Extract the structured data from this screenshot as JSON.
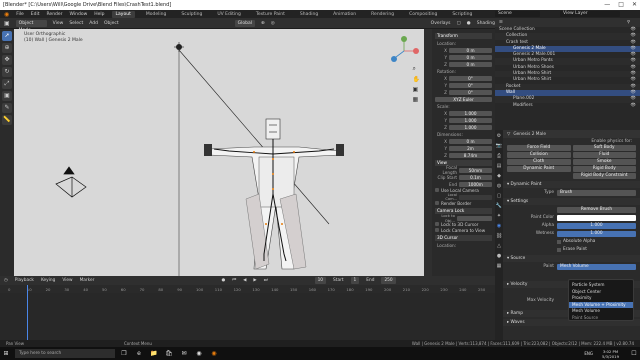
{
  "window": {
    "title": "[Blender* [C:\\Users\\Will\\Google Drive\\Blend Files\\CrashTest1.blend]",
    "controls": [
      "—",
      "□",
      "✕"
    ]
  },
  "menubar": {
    "menus": [
      "File",
      "Edit",
      "Render",
      "Window",
      "Help"
    ],
    "workspaces": [
      "Layout",
      "Modeling",
      "Sculpting",
      "UV Editing",
      "Texture Paint",
      "Shading",
      "Animation",
      "Rendering",
      "Compositing",
      "Scripting"
    ],
    "active_workspace": "Layout",
    "scene": "Scene",
    "view_layer": "View Layer"
  },
  "viewport_header": {
    "mode": "Object Mode",
    "menus": [
      "View",
      "Select",
      "Add",
      "Object"
    ],
    "transform": "Global",
    "overlays": "Overlays",
    "shading": "Shading"
  },
  "viewport": {
    "view_name": "User Orthographic",
    "object_name": "(10) Wall | Genesis 2 Male"
  },
  "tool_icons": [
    "cursor-icon",
    "move-icon",
    "rotate-icon",
    "scale-icon",
    "transform-icon",
    "annotate-icon",
    "measure-icon"
  ],
  "npanel": {
    "transform_title": "Transform",
    "location_label": "Location:",
    "location": {
      "x": "0 m",
      "y": "0 m",
      "z": "0 m"
    },
    "rotation_label": "Rotation:",
    "rotation": {
      "x": "0°",
      "y": "0°",
      "z": "0°"
    },
    "rotation_mode": "XYZ Euler",
    "scale_label": "Scale:",
    "scale": {
      "x": "1.000",
      "y": "1.000",
      "z": "1.000"
    },
    "dimensions_label": "Dimensions:",
    "dimensions": {
      "x": "0 m",
      "y": "2m",
      "z": "8.74m"
    },
    "view_title": "View",
    "focal_length_label": "Focal Length",
    "focal_length": "50mm",
    "clip_start_label": "Clip Start",
    "clip_start": "0.1m",
    "clip_end_label": "End",
    "clip_end": "1000m",
    "use_local_camera": "Use Local Camera",
    "local_camera_label": "Local Cam...",
    "render_border": "Render Border",
    "camera_lock_title": "Camera Lock",
    "lock_to_obj": "Lock to Obj...",
    "lock_to_3d_cursor": "Lock to 3D Cursor",
    "lock_camera_to_view": "Lock Camera to View",
    "cursor_title": "3D Cursor",
    "cursor_location_label": "Location:"
  },
  "outliner": {
    "rows": [
      {
        "label": "Scene Collection",
        "indent": 0,
        "selected": false
      },
      {
        "label": "Collection",
        "indent": 1,
        "selected": false
      },
      {
        "label": "Crash test",
        "indent": 1,
        "selected": false
      },
      {
        "label": "Genesis 2 Male",
        "indent": 2,
        "selected": true
      },
      {
        "label": "Genesis 2 Male.001",
        "indent": 2,
        "selected": false
      },
      {
        "label": "Urban Metro Pants",
        "indent": 2,
        "selected": false
      },
      {
        "label": "Urban Metro Shoes",
        "indent": 2,
        "selected": false
      },
      {
        "label": "Urban Metro Shirt",
        "indent": 2,
        "selected": false
      },
      {
        "label": "Urban Metro Shirt",
        "indent": 2,
        "selected": false
      },
      {
        "label": "Rocket",
        "indent": 1,
        "selected": false
      },
      {
        "label": "Wall",
        "indent": 1,
        "selected": true
      },
      {
        "label": "Plane.002",
        "indent": 2,
        "selected": false
      },
      {
        "label": "Modifiers",
        "indent": 2,
        "selected": false
      }
    ]
  },
  "properties": {
    "object_name": "Genesis 2 Male",
    "enable_physics_for": "Enable physics for:",
    "physics_buttons": [
      [
        "Force Field",
        "Soft Body"
      ],
      [
        "Collision",
        "Fluid"
      ],
      [
        "Cloth",
        "Smoke"
      ],
      [
        "Dynamic Paint",
        "Rigid Body"
      ],
      [
        "",
        "Rigid Body Constraint"
      ]
    ],
    "dynamic_paint_title": "Dynamic Paint",
    "type_label": "Type",
    "type_value": "Brush",
    "settings_title": "Settings",
    "remove_brush": "Remove Brush",
    "paint_color_label": "Paint Color",
    "paint_color": "#ffffff",
    "alpha_label": "Alpha",
    "alpha_value": "1.000",
    "wetness_label": "Wetness",
    "wetness_value": "1.000",
    "absolute_alpha": "Absolute Alpha",
    "erase_paint": "Erase Paint",
    "source_title": "Source",
    "paint_label": "Paint",
    "paint_value": "Mesh Volume",
    "velocity_title": "Velocity",
    "max_velocity_label": "Max Velocity",
    "ramp_title": "Ramp",
    "waves_title": "Waves"
  },
  "dropdown": {
    "items": [
      "Particle System",
      "Object Center",
      "Proximity",
      "Mesh Volume + Proximity",
      "Mesh Volume"
    ],
    "highlighted": "Mesh Volume + Proximity",
    "footer": "Paint Source"
  },
  "timeline": {
    "menus": [
      "Playback",
      "Keying",
      "View",
      "Marker"
    ],
    "current_frame": "10",
    "start_label": "Start",
    "start": "1",
    "end_label": "End",
    "end": "250",
    "ruler_ticks": [
      "0",
      "10",
      "20",
      "30",
      "40",
      "50",
      "60",
      "70",
      "80",
      "90",
      "100",
      "110",
      "120",
      "130",
      "140",
      "150",
      "160",
      "170",
      "180",
      "190",
      "200",
      "210",
      "220",
      "230",
      "240",
      "250"
    ]
  },
  "statusbar": {
    "left": "Pan View",
    "middle": "Context Menu",
    "stats": "Wall | Genesis 2 Male | Verts:113,874 | Faces:111,609 | Tris:223,082 | Objects:2/12 | Mem: 222.4 MB | v2.80.74"
  },
  "taskbar": {
    "search": "Type here to search",
    "time": "3:02 PM",
    "date": "5/3/2019",
    "language": "ENG"
  },
  "colors": {
    "accent": "#4772b3",
    "selection": "#334d80",
    "viewport_bg": "#d8d8d8",
    "playhead": "#4a86e8"
  }
}
